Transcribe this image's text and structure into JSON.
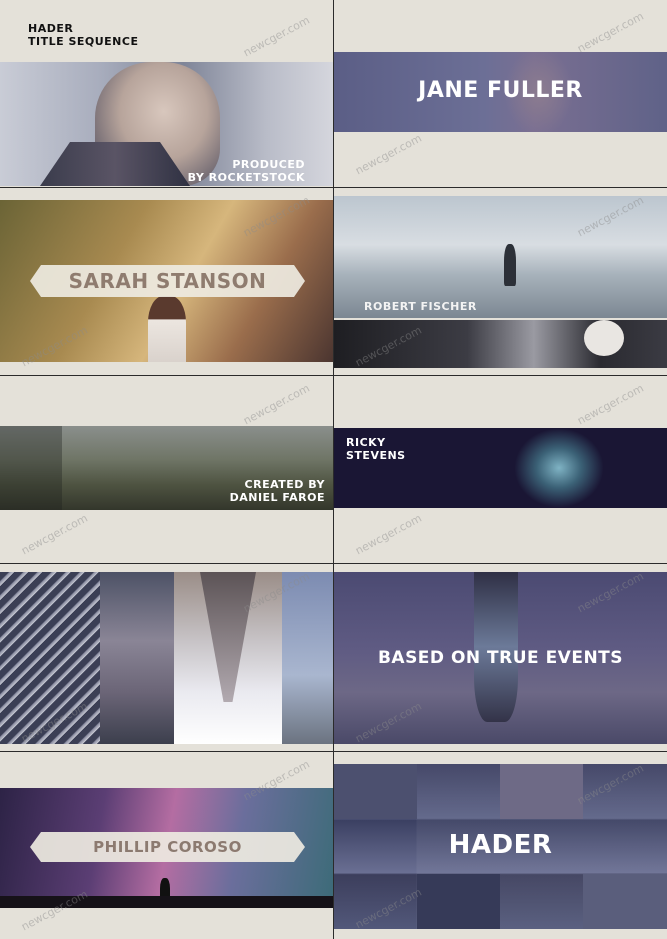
{
  "watermark": "newcger.com",
  "panels": {
    "p1": {
      "title_line1": "HADER",
      "title_line2": "TITLE SEQUENCE",
      "credit_line1": "PRODUCED",
      "credit_line2": "BY ROCKETSTOCK"
    },
    "p2": {
      "name": "JANE FULLER"
    },
    "p3": {
      "name": "SARAH STANSON"
    },
    "p4": {
      "name": "ROBERT FISCHER"
    },
    "p5": {
      "credit_line1": "CREATED BY",
      "credit_line2": "DANIEL FAROE"
    },
    "p6": {
      "name_line1": "RICKY",
      "name_line2": "STEVENS"
    },
    "p8": {
      "caption": "BASED ON TRUE EVENTS"
    },
    "p9": {
      "name": "PHILLIP COROSO"
    },
    "p10": {
      "title": "HADER"
    }
  }
}
